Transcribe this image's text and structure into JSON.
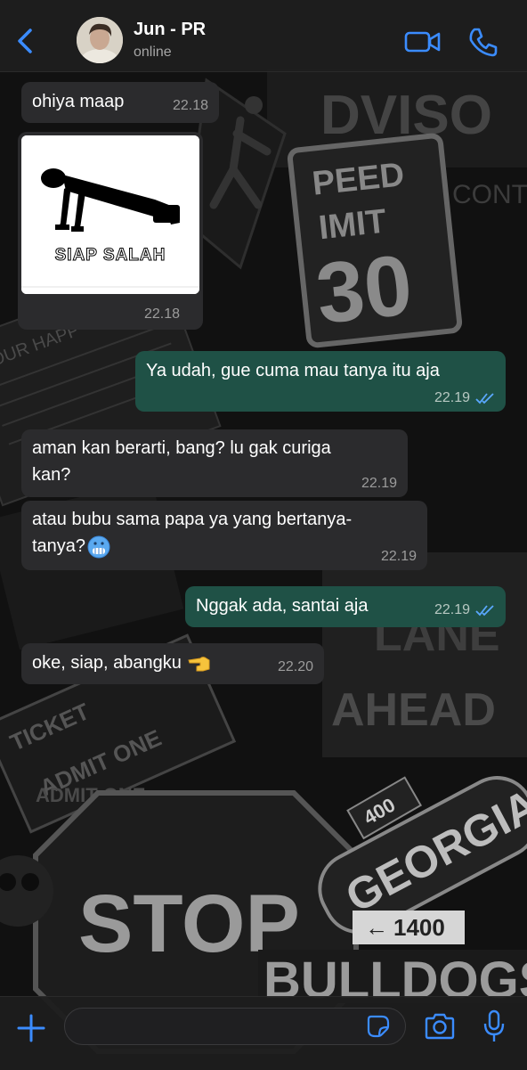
{
  "header": {
    "contact_name": "Jun - PR",
    "status": "online"
  },
  "messages": [
    {
      "direction": "in",
      "text": "ohiya maap",
      "time": "22.18"
    },
    {
      "direction": "in",
      "type": "image",
      "image_caption": "SIAP SALAH",
      "time": "22.18"
    },
    {
      "direction": "out",
      "text": "Ya udah, gue cuma mau tanya itu aja",
      "time": "22.19",
      "read": true
    },
    {
      "direction": "in",
      "text": "aman kan berarti, bang? lu gak curiga\nkan?",
      "time": "22.19"
    },
    {
      "direction": "in",
      "text": "atau bubu sama papa ya yang bertanya-\ntanya?",
      "emoji": "cold-face-emoji",
      "time": "22.19"
    },
    {
      "direction": "out",
      "text": "Nggak ada, santai aja",
      "time": "22.19",
      "read": true
    },
    {
      "direction": "in",
      "text": "oke, siap, abangku",
      "emoji": "backhand-index-pointing-left-emoji",
      "time": "22.20"
    }
  ],
  "wallpaper_signs": {
    "advisory": "DVISO",
    "speed_limit_top": "PEED",
    "speed_limit_mid": "IMIT",
    "speed_limit_value": "30",
    "lane": "LANE",
    "ahead": "AHEAD",
    "admit_one": "ADMIT ONE",
    "stop": "STOP",
    "georgia": "GEORGIA",
    "route_400": "400",
    "route_1400": "1400",
    "bulldogs": "BULLDOGS",
    "ticket": "TICKET",
    "your_happy": "YOUR HAPP",
    "cont": "CONT"
  },
  "composer": {
    "placeholder": ""
  },
  "colors": {
    "incoming_bubble": "#2b2b2d",
    "outgoing_bubble": "#1f5146",
    "accent": "#3b8cff",
    "read_ticks": "#5aa8ff"
  }
}
